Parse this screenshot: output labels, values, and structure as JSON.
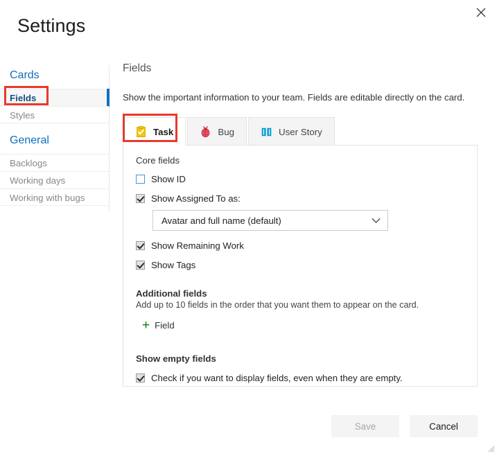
{
  "dialog": {
    "title": "Settings",
    "close_icon": "close-x-icon"
  },
  "sidebar": {
    "groups": [
      {
        "title": "Cards",
        "items": [
          {
            "label": "Fields",
            "selected": true
          },
          {
            "label": "Styles",
            "selected": false
          }
        ]
      },
      {
        "title": "General",
        "items": [
          {
            "label": "Backlogs",
            "selected": false
          },
          {
            "label": "Working days",
            "selected": false
          },
          {
            "label": "Working with bugs",
            "selected": false
          }
        ]
      }
    ]
  },
  "main": {
    "heading": "Fields",
    "description": "Show the important information to your team. Fields are editable directly on the card.",
    "tabs": [
      {
        "label": "Task",
        "icon": "task-clipboard-icon",
        "active": true
      },
      {
        "label": "Bug",
        "icon": "bug-ladybug-icon",
        "active": false
      },
      {
        "label": "User Story",
        "icon": "user-story-book-icon",
        "active": false
      }
    ],
    "core_fields": {
      "label": "Core fields",
      "show_id": {
        "label": "Show ID",
        "checked": false
      },
      "show_assigned_to": {
        "label": "Show Assigned To as:",
        "checked": true
      },
      "assigned_to_select": {
        "value": "Avatar and full name (default)",
        "chevron_icon": "chevron-down-icon"
      },
      "show_remaining_work": {
        "label": "Show Remaining Work",
        "checked": true
      },
      "show_tags": {
        "label": "Show Tags",
        "checked": true
      }
    },
    "additional_fields": {
      "label": "Additional fields",
      "description": "Add up to 10 fields in the order that you want them to appear on the card.",
      "add_button": {
        "label": "Field",
        "icon": "plus-icon"
      }
    },
    "show_empty_fields": {
      "label": "Show empty fields",
      "checkbox": {
        "label": "Check if you want to display fields, even when they are empty.",
        "checked": true
      }
    }
  },
  "footer": {
    "save_label": "Save",
    "cancel_label": "Cancel"
  },
  "colors": {
    "accent_blue": "#106ebe",
    "annotation_red": "#e8392a",
    "plus_green": "#107c10",
    "task_yellow": "#f2c811",
    "bug_red": "#cc293d",
    "story_blue": "#009ccc"
  }
}
